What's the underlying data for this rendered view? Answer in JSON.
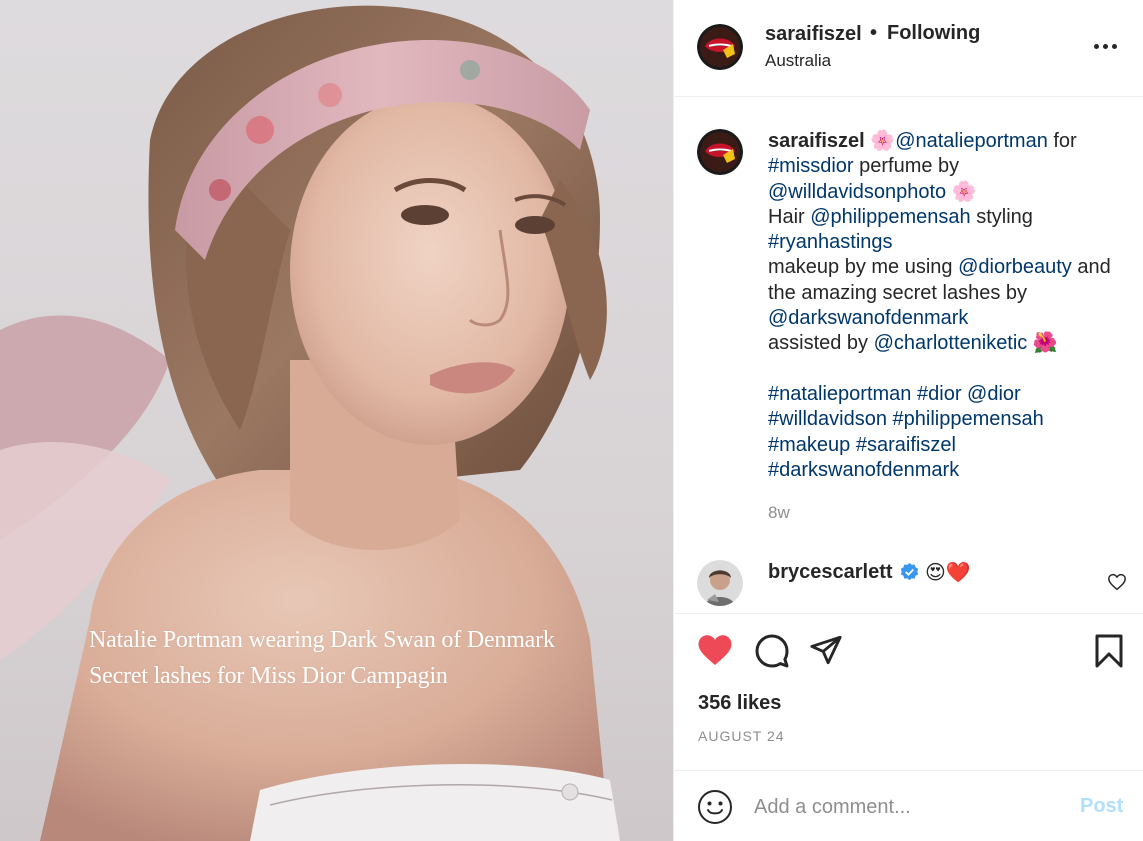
{
  "photo": {
    "caption_line1": "Natalie Portman wearing Dark Swan of Denmark",
    "caption_line2": "Secret lashes for Miss Dior Campagin"
  },
  "header": {
    "username": "saraifiszel",
    "separator": "•",
    "follow_status": "Following",
    "location": "Australia",
    "more_icon": "more-horizontal-icon"
  },
  "caption": {
    "username": "saraifiszel",
    "lines": [
      [
        "🌸",
        "@natalieportman",
        " for"
      ],
      [
        "#missdior",
        " perfume by"
      ],
      [
        "@willdavidsonphoto",
        " 🌸"
      ],
      [
        "Hair ",
        "@philippemensah",
        " styling"
      ],
      [
        "#ryanhastings"
      ],
      [
        "makeup by me using ",
        "@diorbeauty",
        " and"
      ],
      [
        "the amazing secret lashes by"
      ],
      [
        "@darkswanofdenmark"
      ],
      [
        "assisted by ",
        "@charlotteniketic",
        " 🌺"
      ],
      [
        "#natalieportman",
        " ",
        "#dior",
        " ",
        "@dior"
      ],
      [
        "#willdavidson",
        " ",
        "#philippemensah"
      ],
      [
        "#makeup",
        " ",
        "#saraifiszel"
      ],
      [
        "#darkswanofdenmark"
      ]
    ],
    "time": "8w"
  },
  "comment": {
    "username": "brycescarlett",
    "emoji": "😍❤️",
    "verified_icon": "verified-badge-icon",
    "like_icon": "heart-outline-icon"
  },
  "actions": {
    "like_icon": "heart-filled-icon",
    "comment_icon": "comment-icon",
    "share_icon": "share-icon",
    "save_icon": "bookmark-icon",
    "likes": "356 likes",
    "date": "AUGUST 24"
  },
  "add_comment": {
    "placeholder": "Add a comment...",
    "post_label": "Post",
    "emoji_icon": "smiley-icon"
  },
  "colors": {
    "link": "#00376b",
    "like_red": "#ed4956",
    "verified_blue": "#3897f0",
    "post_disabled": "#b2dffc",
    "muted": "#8e8e8e"
  }
}
